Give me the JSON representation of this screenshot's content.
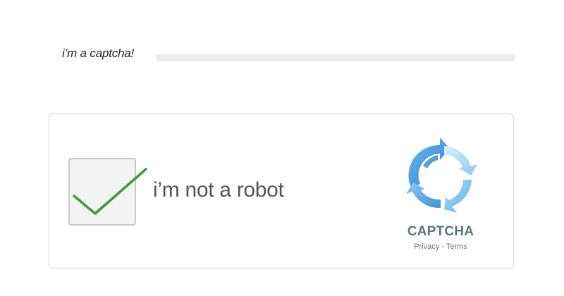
{
  "header": {
    "label": "i’m a captcha!"
  },
  "captcha": {
    "checkbox_checked": true,
    "label": "i’m not a robot",
    "brand": "CAPTCHA",
    "privacy_link": "Privacy",
    "separator": " - ",
    "terms_link": "Terms"
  },
  "colors": {
    "checkmark": "#3d9a3d",
    "logo_light": "#9fd3f3",
    "logo_dark": "#2d83d0",
    "brand_text": "#5c7485",
    "label_text": "#555555"
  },
  "icons": {
    "checkbox": "checkmark-icon",
    "logo": "recaptcha-logo-icon"
  }
}
